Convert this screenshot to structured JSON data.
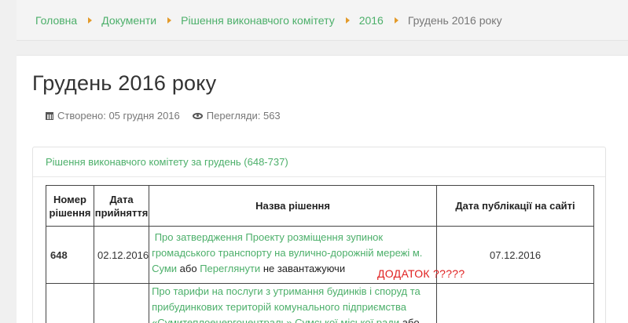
{
  "breadcrumb": {
    "items": [
      "Головна",
      "Документи",
      "Рішення виконавчого комітету",
      "2016"
    ],
    "current": "Грудень 2016 року"
  },
  "page": {
    "title": "Грудень 2016 року",
    "created_label": "Створено:",
    "created_date": "05 грудня 2016",
    "views_label": "Перегляди:",
    "views_count": "563"
  },
  "panel": {
    "heading": "Рішення виконавчого комітету за грудень (648-737)"
  },
  "table": {
    "headers": {
      "number_line1": "Номер",
      "number_line2": "рішення",
      "date_line1": "Дата",
      "date_line2": "прийняття",
      "name": "Назва рішення",
      "published": "Дата публікації на сайті"
    },
    "rows": [
      {
        "number": "648",
        "date": "02.12.2016",
        "title_link": "Про затвердження Проекту розміщення зупинок громадського транспорту на вулично-дорожній мережі м. Суми",
        "or1": "або",
        "view_link": "Переглянути",
        "tail": "не завантажуючи",
        "published": "07.12.2016"
      },
      {
        "number": "",
        "date": "",
        "title_link": "Про тарифи на послуги з утримання будинків і споруд та прибудинкових територій комунального підприємства «Сумитеплоенергоцентраль» Сумської міської ради",
        "or1": "або",
        "published": ""
      }
    ]
  },
  "annotation": "ДОДАТОК ?????",
  "colors": {
    "link": "#4caf6a",
    "separator": "#e39a2a",
    "annotation": "#e02020"
  }
}
